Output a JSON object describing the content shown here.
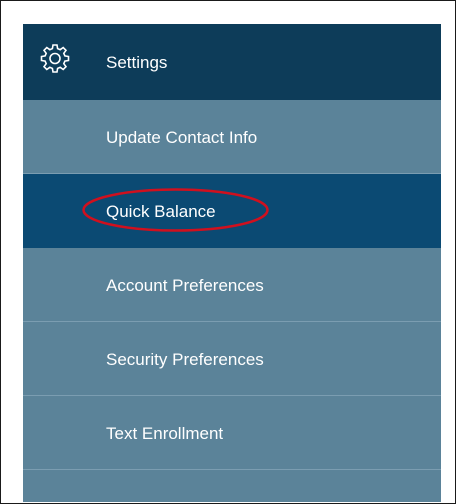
{
  "menu": {
    "header": {
      "label": "Settings",
      "icon": "gear-icon"
    },
    "items": [
      {
        "label": "Update Contact Info"
      },
      {
        "label": "Quick Balance",
        "active": true
      },
      {
        "label": "Account Preferences"
      },
      {
        "label": "Security Preferences"
      },
      {
        "label": "Text Enrollment"
      }
    ]
  },
  "colors": {
    "header_bg": "#0d3c59",
    "menu_bg": "#5b8399",
    "active_bg": "#0b4a73",
    "highlight": "#d0101e"
  }
}
